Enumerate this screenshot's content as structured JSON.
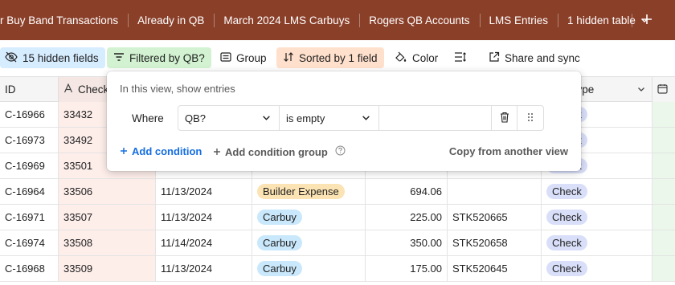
{
  "tabs": [
    {
      "label": "r Buy Band Transactions"
    },
    {
      "label": "Already in QB"
    },
    {
      "label": "March 2024 LMS Carbuys"
    },
    {
      "label": "Rogers QB Accounts"
    },
    {
      "label": "LMS Entries"
    },
    {
      "label": "1 hidden table"
    }
  ],
  "toolbar": {
    "hidden_fields": "15 hidden fields",
    "filter": "Filtered by QB?",
    "group": "Group",
    "sort": "Sorted by 1 field",
    "color": "Color",
    "share": "Share and sync"
  },
  "columns": {
    "id": "ID",
    "check": "Check",
    "type": "mentType"
  },
  "rows": [
    {
      "id": "C-16966",
      "check": "33432",
      "date": "",
      "category": "",
      "amount": "",
      "stk": "",
      "type": "Check"
    },
    {
      "id": "C-16973",
      "check": "33492",
      "date": "",
      "category": "",
      "amount": "",
      "stk": "",
      "type": "Check"
    },
    {
      "id": "C-16969",
      "check": "33501",
      "date": "",
      "category": "",
      "amount": "",
      "stk": "",
      "type": "Check"
    },
    {
      "id": "C-16964",
      "check": "33506",
      "date": "11/13/2024",
      "category": "Builder Expense",
      "amount": "694.06",
      "stk": "",
      "type": "Check"
    },
    {
      "id": "C-16971",
      "check": "33507",
      "date": "11/13/2024",
      "category": "Carbuy",
      "amount": "225.00",
      "stk": "STK520665",
      "type": "Check"
    },
    {
      "id": "C-16974",
      "check": "33508",
      "date": "11/14/2024",
      "category": "Carbuy",
      "amount": "350.00",
      "stk": "STK520658",
      "type": "Check"
    },
    {
      "id": "C-16968",
      "check": "33509",
      "date": "11/13/2024",
      "category": "Carbuy",
      "amount": "175.00",
      "stk": "STK520645",
      "type": "Check"
    }
  ],
  "filter_popover": {
    "title": "In this view, show entries",
    "where": "Where",
    "field": "QB?",
    "operator": "is empty",
    "value": "",
    "add_condition": "Add condition",
    "add_condition_group": "Add condition group",
    "copy_from_view": "Copy from another view"
  },
  "colors": {
    "tabbar": "#8a3f29",
    "hidden_fields_bg": "#d6ecff",
    "filter_bg": "#d2f2d1",
    "sort_bg": "#ffe0cc",
    "carbuy_pill": "#c9e8fb",
    "builder_pill": "#fbe3b3",
    "check_pill": "#d9dff9",
    "link_blue": "#166ee1"
  },
  "icons": [
    "chevron-down-icon",
    "plus-icon",
    "eye-slash-icon",
    "filter-icon",
    "group-icon",
    "sort-icon",
    "color-icon",
    "row-height-icon",
    "share-icon",
    "text-field-icon",
    "trash-icon",
    "drag-handle-icon",
    "help-icon"
  ]
}
